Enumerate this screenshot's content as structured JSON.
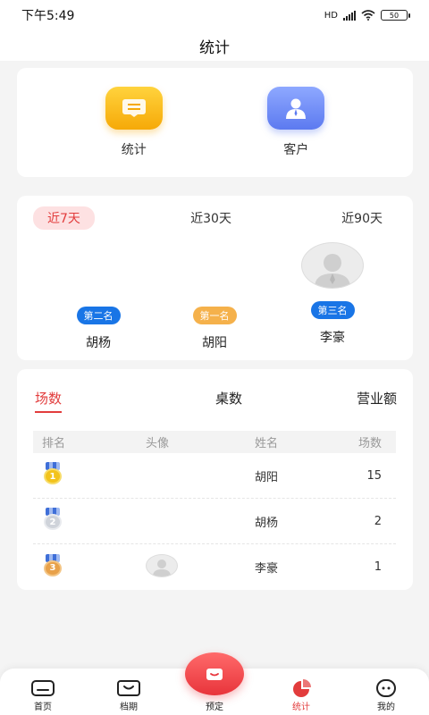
{
  "status_bar": {
    "time": "下午5:49",
    "network": "HD",
    "battery": "50"
  },
  "header": {
    "title": "统计"
  },
  "quick_entries": [
    {
      "label": "统计",
      "icon": "report-icon",
      "color": "#f6a908"
    },
    {
      "label": "客户",
      "icon": "customer-icon",
      "color": "#5c7af0"
    }
  ],
  "ranking": {
    "periods": [
      "近7天",
      "近30天",
      "近90天"
    ],
    "active_period": "近7天",
    "podium": [
      {
        "badge": "第二名",
        "name": "胡杨"
      },
      {
        "badge": "第一名",
        "name": "胡阳"
      },
      {
        "badge": "第三名",
        "name": "李豪"
      }
    ]
  },
  "stats": {
    "tabs": [
      "场数",
      "桌数",
      "营业额"
    ],
    "active_tab": "场数",
    "columns": [
      "排名",
      "头像",
      "姓名",
      "场数"
    ],
    "rows": [
      {
        "rank": "1",
        "name": "胡阳",
        "value": "15"
      },
      {
        "rank": "2",
        "name": "胡杨",
        "value": "2"
      },
      {
        "rank": "3",
        "name": "李豪",
        "value": "1"
      }
    ]
  },
  "bottom_nav": {
    "items": [
      "首页",
      "档期",
      "预定",
      "统计",
      "我的"
    ],
    "active": "统计"
  },
  "colors": {
    "accent": "#e23c3c",
    "badge_blue": "#1975e6",
    "badge_orange": "#f5b14b",
    "gold": "#f2c31c",
    "silver": "#cfd3da",
    "bronze": "#e8a14a"
  }
}
